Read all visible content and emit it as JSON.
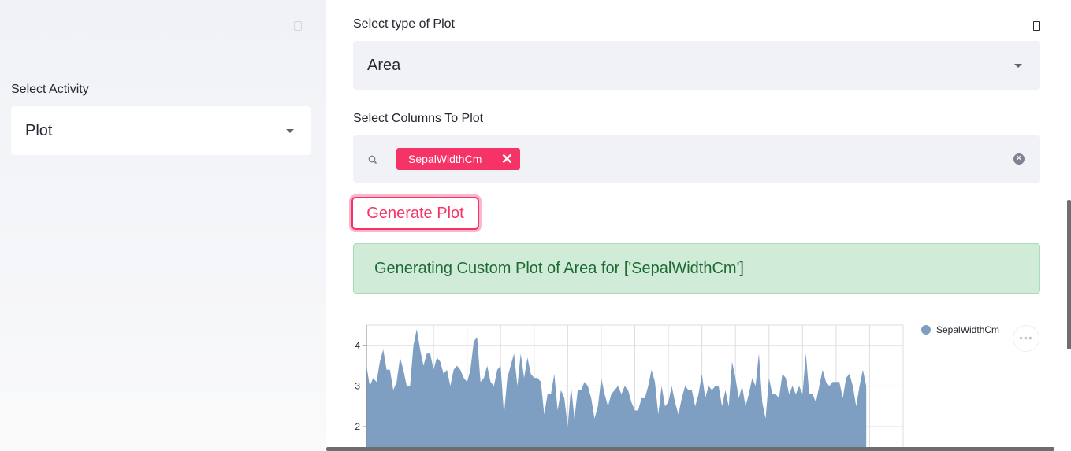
{
  "sidebar": {
    "activity_label": "Select Activity",
    "activity_value": "Plot"
  },
  "main": {
    "plot_type_label": "Select type of Plot",
    "plot_type_value": "Area",
    "columns_label": "Select Columns To Plot",
    "selected_columns": [
      "SepalWidthCm"
    ],
    "generate_button": "Generate Plot",
    "status_message": "Generating Custom Plot of Area for ['SepalWidthCm']"
  },
  "colors": {
    "accent": "#f63366",
    "area_fill": "#7f9fc2",
    "success_bg": "#d0ecd8",
    "success_text": "#1e6a33"
  },
  "chart_data": {
    "type": "area",
    "series": [
      {
        "name": "SepalWidthCm",
        "values": [
          3.5,
          3.0,
          3.2,
          3.1,
          3.6,
          3.9,
          3.4,
          3.4,
          2.9,
          3.1,
          3.7,
          3.4,
          3.0,
          3.0,
          4.0,
          4.4,
          3.9,
          3.5,
          3.8,
          3.8,
          3.4,
          3.7,
          3.6,
          3.3,
          3.4,
          3.0,
          3.4,
          3.5,
          3.4,
          3.2,
          3.1,
          3.4,
          4.1,
          4.2,
          3.1,
          3.2,
          3.5,
          3.1,
          3.0,
          3.4,
          3.5,
          2.3,
          3.2,
          3.5,
          3.8,
          3.0,
          3.8,
          3.2,
          3.7,
          3.3,
          3.2,
          3.2,
          3.1,
          2.3,
          2.8,
          2.8,
          3.3,
          2.4,
          2.9,
          2.7,
          2.0,
          3.0,
          2.2,
          2.9,
          2.9,
          3.1,
          3.0,
          2.7,
          2.2,
          2.5,
          3.2,
          2.8,
          2.5,
          2.8,
          2.9,
          3.0,
          2.8,
          3.0,
          2.9,
          2.6,
          2.4,
          2.4,
          2.7,
          2.7,
          3.0,
          3.4,
          3.1,
          2.3,
          3.0,
          2.5,
          2.6,
          3.0,
          2.6,
          2.3,
          2.7,
          3.0,
          2.9,
          2.9,
          2.5,
          2.8,
          3.3,
          2.7,
          3.0,
          2.9,
          3.0,
          3.0,
          2.5,
          2.9,
          2.5,
          3.6,
          3.2,
          2.7,
          3.0,
          2.5,
          2.8,
          3.2,
          3.0,
          3.8,
          2.6,
          2.2,
          3.2,
          2.8,
          2.8,
          2.7,
          3.3,
          3.2,
          2.8,
          3.0,
          2.8,
          3.0,
          2.8,
          3.8,
          2.8,
          2.8,
          2.6,
          3.0,
          3.4,
          3.1,
          3.0,
          3.1,
          3.1,
          3.1,
          2.7,
          3.2,
          3.3,
          3.0,
          2.5,
          3.0,
          3.4,
          3.0
        ]
      }
    ],
    "x_range": [
      0,
      160
    ],
    "ylim": [
      1.4,
      4.5
    ],
    "y_ticks": [
      2,
      3,
      4
    ],
    "grid": true,
    "legend": "top-right"
  }
}
